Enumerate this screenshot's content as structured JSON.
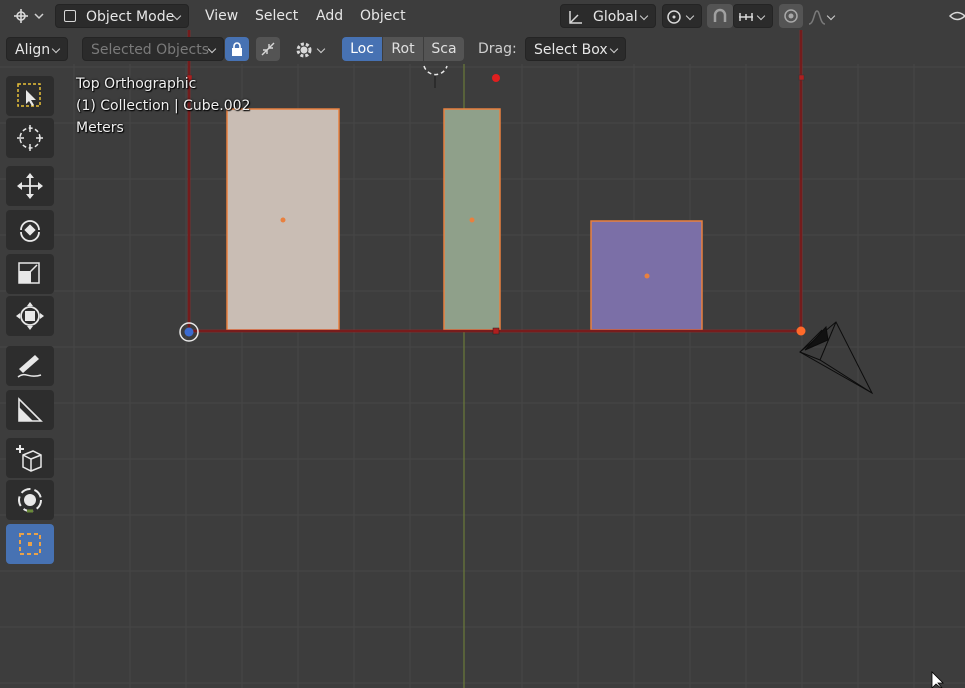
{
  "header": {
    "editor_type_icon": "editor-type-icon",
    "mode_label": "Object Mode",
    "menus": [
      "View",
      "Select",
      "Add",
      "Object"
    ],
    "transform_orientation": "Global"
  },
  "tool_settings": {
    "align_label": "Align",
    "affect_label": "Selected Objects",
    "segments": [
      "Loc",
      "Rot",
      "Sca"
    ],
    "active_segment": "Loc",
    "drag_label": "Drag:",
    "drag_value": "Select Box"
  },
  "viewport": {
    "view_name": "Top Orthographic",
    "collection_info": "(1) Collection | Cube.002",
    "units": "Meters"
  },
  "objects": [
    {
      "name": "cube-left",
      "color": "#c9bdb4"
    },
    {
      "name": "cube-middle",
      "color": "#8fa08a"
    },
    {
      "name": "cube-right",
      "color": "#7b6fa7"
    }
  ],
  "colors": {
    "accent": "#4772b3",
    "selection_outline": "#e9803e",
    "frame_red": "#b01f1f",
    "background": "#3d3d3d"
  },
  "toolbar": [
    "select-box-tool",
    "cursor-tool",
    "move-tool",
    "rotate-tool",
    "scale-tool",
    "transform-tool",
    "annotate-tool",
    "measure-tool",
    "add-cube-tool",
    "camera-tool",
    "active-select-tool"
  ]
}
